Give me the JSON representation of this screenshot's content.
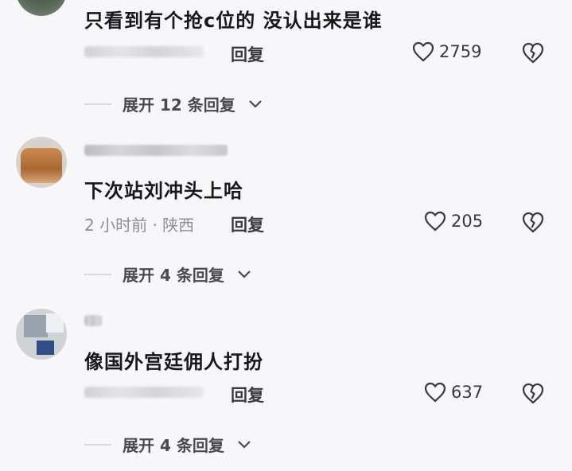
{
  "comments": [
    {
      "text": "只看到有个抢c位的 没认出来是谁",
      "meta": "",
      "reply_label": "回复",
      "likes": "2759",
      "expand_label": "展开 12 条回复"
    },
    {
      "text": "下次站刘冲头上哈",
      "meta": "2 小时前 · 陕西",
      "reply_label": "回复",
      "likes": "205",
      "expand_label": "展开 4 条回复"
    },
    {
      "text": "像国外宫廷佣人打扮",
      "meta": "",
      "reply_label": "回复",
      "likes": "637",
      "expand_label": "展开 4 条回复"
    }
  ],
  "colors": {
    "background": "#f7f7f9",
    "text": "#18181a",
    "muted": "#8e8e93"
  },
  "icons": {
    "like": "heart-outline-icon",
    "dislike": "broken-heart-icon",
    "expand": "chevron-down-icon"
  }
}
